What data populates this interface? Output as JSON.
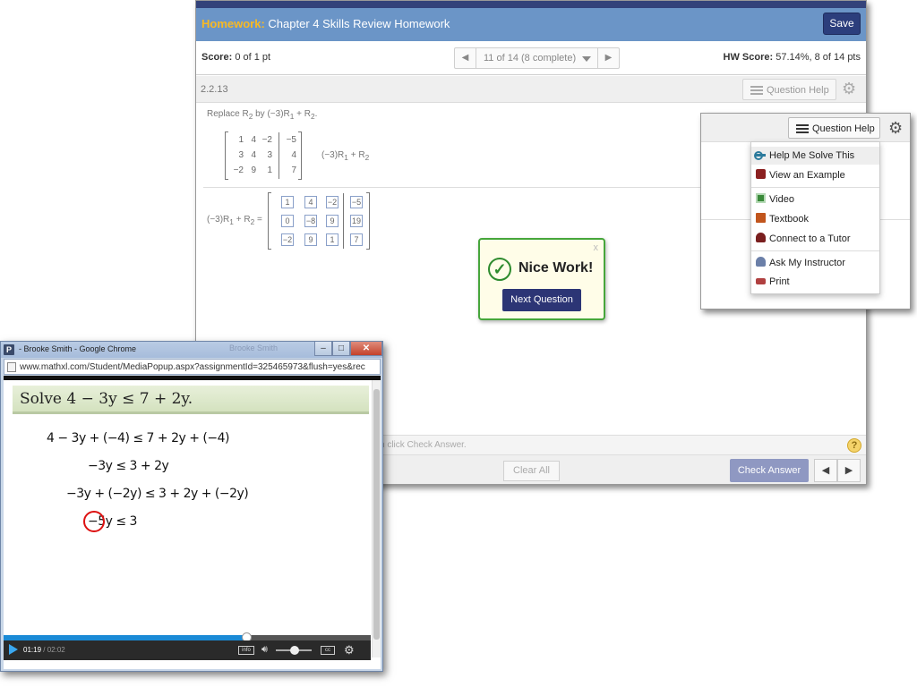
{
  "homework": {
    "label": "Homework:",
    "title": "Chapter 4 Skills Review Homework",
    "save_label": "Save",
    "score_label": "Score:",
    "score_value": "0 of 1 pt",
    "pager_label": "11 of 14 (8 complete)",
    "hw_score_label": "HW Score:",
    "hw_score_value": "57.14%, 8 of 14 pts",
    "question_number": "2.2.13",
    "question_help_label": "Question Help",
    "hint_text": "n click Check Answer.",
    "help_symbol": "?",
    "clear_all_label": "Clear All",
    "check_answer_label": "Check Answer",
    "prev_symbol": "◀",
    "next_symbol": "▶"
  },
  "question": {
    "instruction_parts": [
      "Replace R",
      "2",
      " by (−3)R",
      "1",
      " + R",
      "2",
      "."
    ],
    "operation_parts": [
      "(−3)R",
      "1",
      " + R",
      "2"
    ],
    "result_label_parts": [
      "(−3)R",
      "1",
      " + R",
      "2",
      " ="
    ],
    "matrix": [
      [
        "1",
        "4",
        "−2",
        "−5"
      ],
      [
        "3",
        "4",
        "3",
        "4"
      ],
      [
        "−2",
        "9",
        "1",
        "7"
      ]
    ],
    "answer_matrix": [
      [
        "1",
        "4",
        "−2",
        "−5"
      ],
      [
        "0",
        "−8",
        "9",
        "19"
      ],
      [
        "−2",
        "9",
        "1",
        "7"
      ]
    ]
  },
  "popup": {
    "close_symbol": "x",
    "check_symbol": "✓",
    "title": "Nice Work!",
    "next_label": "Next Question"
  },
  "help_menu": {
    "button_label": "Question Help",
    "items": [
      {
        "label": "Help Me Solve This",
        "icon": "key-icon"
      },
      {
        "label": "View an Example",
        "icon": "binoculars-icon"
      },
      {
        "label": "Video",
        "icon": "video-icon"
      },
      {
        "label": "Textbook",
        "icon": "textbook-icon"
      },
      {
        "label": "Connect to a Tutor",
        "icon": "tutor-icon"
      },
      {
        "label": "Ask My Instructor",
        "icon": "instructor-icon"
      },
      {
        "label": "Print",
        "icon": "print-icon"
      }
    ]
  },
  "video_window": {
    "app_icon": "P",
    "title": "- Brooke Smith - Google Chrome",
    "title_ghost": "Brooke Smith",
    "url": "www.mathxl.com/Student/MediaPopup.aspx?assignmentId=325465973&flush=yes&rec",
    "problem": "Solve 4 − 3y ≤ 7 + 2y.",
    "steps": [
      "4 − 3y + (−4) ≤ 7 + 2y + (−4)",
      "−3y ≤ 3 + 2y",
      "−3y + (−2y) ≤ 3 + 2y + (−2y)",
      "−5y ≤ 3"
    ],
    "current_time": "01:19",
    "total_time": "/ 02:02",
    "progress": 0.66,
    "info_label": "info",
    "cc_label": "cc"
  },
  "colors": {
    "header_blue": "#6b95c7",
    "navy": "#2c3e7c",
    "homework_gold": "#f7b924",
    "success_green": "#46a63b",
    "progress_blue": "#1a8ad6"
  }
}
